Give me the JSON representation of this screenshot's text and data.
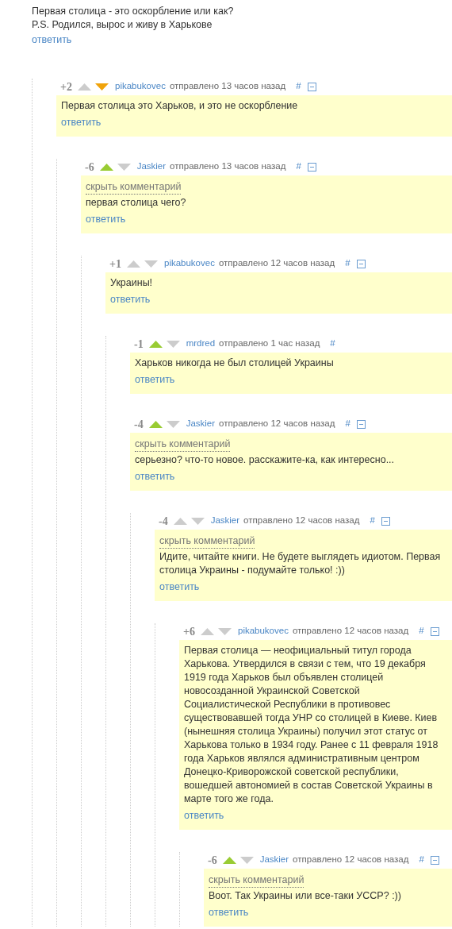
{
  "post": {
    "lines": [
      "Первая столица - это оскорбление или как?",
      "P.S. Родился, вырос и живу в Харькове"
    ],
    "reply": "ответить"
  },
  "comments": [
    {
      "rating": "+2",
      "upvoted": false,
      "downvoted": true,
      "author": "pikabukovec",
      "time": "отправлено 13 часов назад",
      "anchor": "#",
      "collapsible": true,
      "body": "Первая столица это Харьков, и это не оскорбление",
      "reply": "ответить",
      "children": [
        {
          "rating": "-6",
          "upvoted": true,
          "downvoted": false,
          "author": "Jaskier",
          "time": "отправлено 13 часов назад",
          "anchor": "#",
          "collapsible": true,
          "hide": "скрыть комментарий",
          "body": "первая столица чего?",
          "reply": "ответить",
          "children": [
            {
              "rating": "+1",
              "upvoted": false,
              "downvoted": false,
              "author": "pikabukovec",
              "time": "отправлено 12 часов назад",
              "anchor": "#",
              "collapsible": true,
              "body": "Украины!",
              "reply": "ответить",
              "children": [
                {
                  "rating": "-1",
                  "upvoted": true,
                  "downvoted": false,
                  "author": "mrdred",
                  "time": "отправлено 1 час назад",
                  "anchor": "#",
                  "collapsible": false,
                  "body": "Харьков никогда не был столицей Украины",
                  "reply": "ответить"
                },
                {
                  "rating": "-4",
                  "upvoted": true,
                  "downvoted": false,
                  "author": "Jaskier",
                  "time": "отправлено 12 часов назад",
                  "anchor": "#",
                  "collapsible": true,
                  "hide": "скрыть комментарий",
                  "body": "серьезно? что-то новое. расскажите-ка, как интересно...",
                  "reply": "ответить",
                  "children": [
                    {
                      "rating": "-4",
                      "upvoted": false,
                      "downvoted": false,
                      "author": "Jaskier",
                      "time": "отправлено 12 часов назад",
                      "anchor": "#",
                      "collapsible": true,
                      "hide": "скрыть комментарий",
                      "body": "Идите, читайте книги. Не будете выглядеть идиотом. Первая столица Украины - подумайте только! :))",
                      "reply": "ответить",
                      "children": [
                        {
                          "rating": "+6",
                          "upvoted": false,
                          "downvoted": false,
                          "author": "pikabukovec",
                          "time": "отправлено 12 часов назад",
                          "anchor": "#",
                          "collapsible": true,
                          "body": "Первая столица — неофициальный титул города Харькова. Утвердился в связи с тем, что 19 декабря 1919 года Харьков был объявлен столицей новосозданной Украинской Советской Социалистической Республики в противовес существовавшей тогда УНР со столицей в Киеве. Киев (нынешняя столица Украины) получил этот статус от Харькова только в 1934 году. Ранее с 11 февраля 1918 года Харьков являлся административным центром Донецко-Криворожской советской республики, вошедшей автономией в состав Советской Украины в марте того же года.",
                          "reply": "ответить",
                          "children": [
                            {
                              "rating": "-6",
                              "upvoted": true,
                              "downvoted": false,
                              "author": "Jaskier",
                              "time": "отправлено 12 часов назад",
                              "anchor": "#",
                              "collapsible": true,
                              "hide": "скрыть комментарий",
                              "body": "Воот. Так Украины или все-таки УССР? :))",
                              "reply": "ответить"
                            }
                          ]
                        }
                      ]
                    }
                  ]
                }
              ]
            }
          ]
        }
      ]
    }
  ]
}
